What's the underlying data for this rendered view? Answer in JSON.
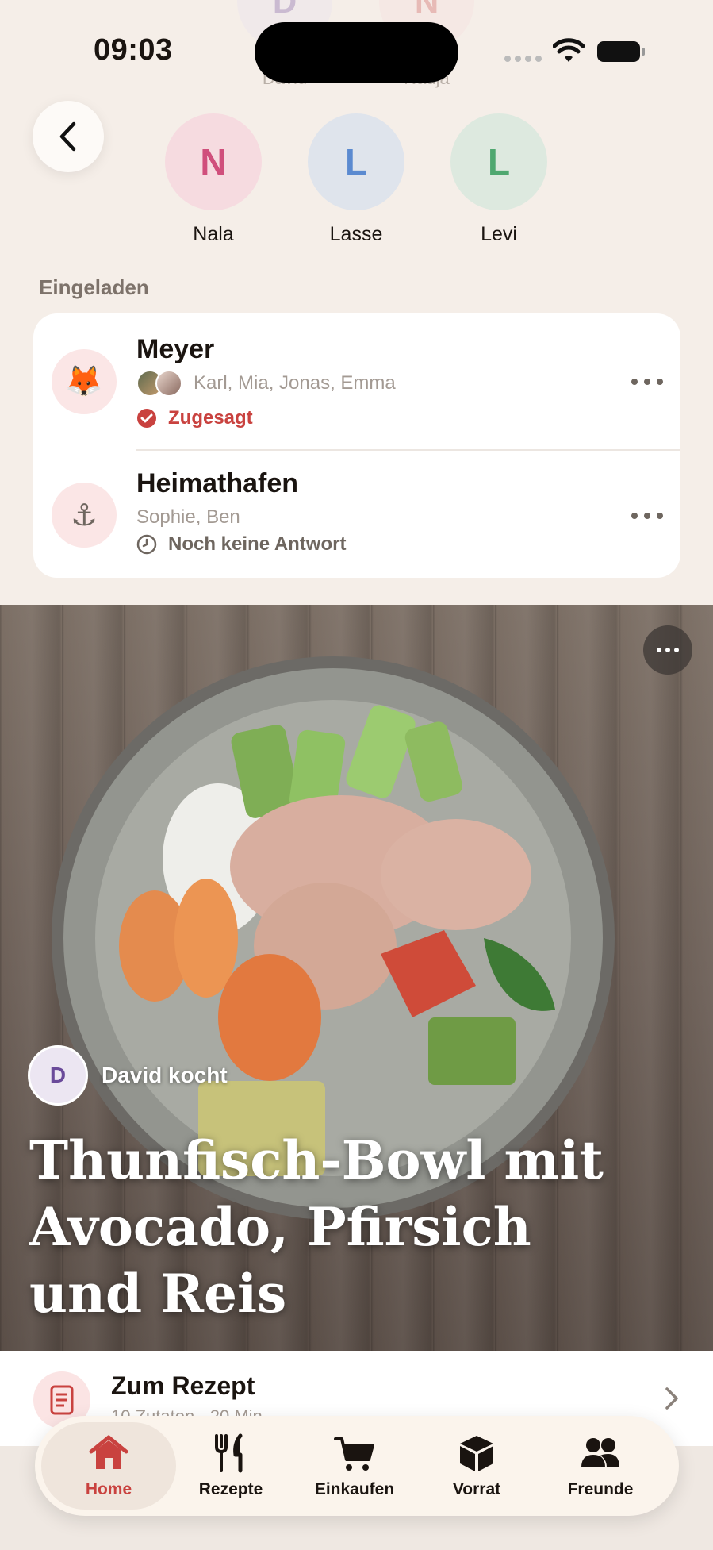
{
  "status_bar": {
    "time": "09:03"
  },
  "faded_header": {
    "people": [
      {
        "initial": "D",
        "name": "David"
      },
      {
        "initial": "N",
        "name": "Nadja"
      }
    ]
  },
  "people": [
    {
      "initial": "N",
      "name": "Nala",
      "bg": "#f6dbe0",
      "fg": "#d04f7c"
    },
    {
      "initial": "L",
      "name": "Lasse",
      "bg": "#dfe4ec",
      "fg": "#5b8ad0"
    },
    {
      "initial": "L",
      "name": "Levi",
      "bg": "#dde9df",
      "fg": "#4fa870"
    }
  ],
  "invited": {
    "title": "Eingeladen",
    "households": [
      {
        "icon": "fox-icon",
        "emoji": "🦊",
        "name": "Meyer",
        "members": "Karl, Mia, Jonas, Emma",
        "status": "Zugesagt",
        "status_color": "#c9423f"
      },
      {
        "icon": "anchor-icon",
        "emoji": "⚓",
        "name": "Heimathafen",
        "members": "Sophie, Ben",
        "status": "Noch keine Antwort",
        "status_color": "#6e665f"
      }
    ]
  },
  "meal": {
    "cook_initial": "D",
    "cook_label": "David kocht",
    "title": "Thunfisch-Bowl mit Avocado, Pfirsich und Reis"
  },
  "recipe_link": {
    "title": "Zum Rezept",
    "subtitle": "10 Zutaten · 20 Min."
  },
  "tabs": [
    {
      "label": "Home",
      "icon": "home-icon",
      "active": true
    },
    {
      "label": "Rezepte",
      "icon": "cutlery-icon",
      "active": false
    },
    {
      "label": "Einkaufen",
      "icon": "cart-icon",
      "active": false
    },
    {
      "label": "Vorrat",
      "icon": "box-icon",
      "active": false
    },
    {
      "label": "Freunde",
      "icon": "friends-icon",
      "active": false
    }
  ],
  "colors": {
    "accent": "#c9423f",
    "background": "#f5eee8"
  }
}
